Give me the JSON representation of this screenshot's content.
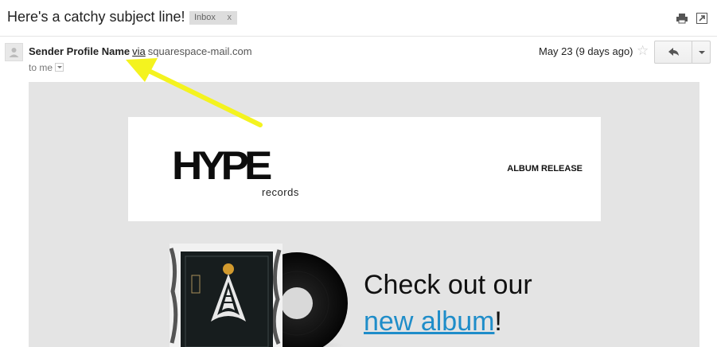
{
  "header": {
    "subject": "Here's a catchy subject line!",
    "label": "Inbox",
    "label_close": "x",
    "print_icon": "print-icon",
    "popout_icon": "new-window-icon"
  },
  "message": {
    "avatar_icon": "person-icon",
    "sender_name": "Sender Profile Name",
    "via": "via",
    "domain": "squarespace-mail.com",
    "to": "to me",
    "date": "May 23 (9 days ago)",
    "star": "☆",
    "reply_icon": "reply-icon",
    "more_icon": "chevron-down-icon"
  },
  "email": {
    "logo_text": "HYPE",
    "logo_subtext": "records",
    "tagline": "ALBUM RELEASE",
    "headline_prefix": "Check out our",
    "headline_link": "new album",
    "headline_suffix": "!",
    "album_art": "album-cover-and-vinyl-image"
  },
  "colors": {
    "email_background": "#e4e4e4",
    "link": "#1f8dc9",
    "arrow": "#f4f31f"
  }
}
